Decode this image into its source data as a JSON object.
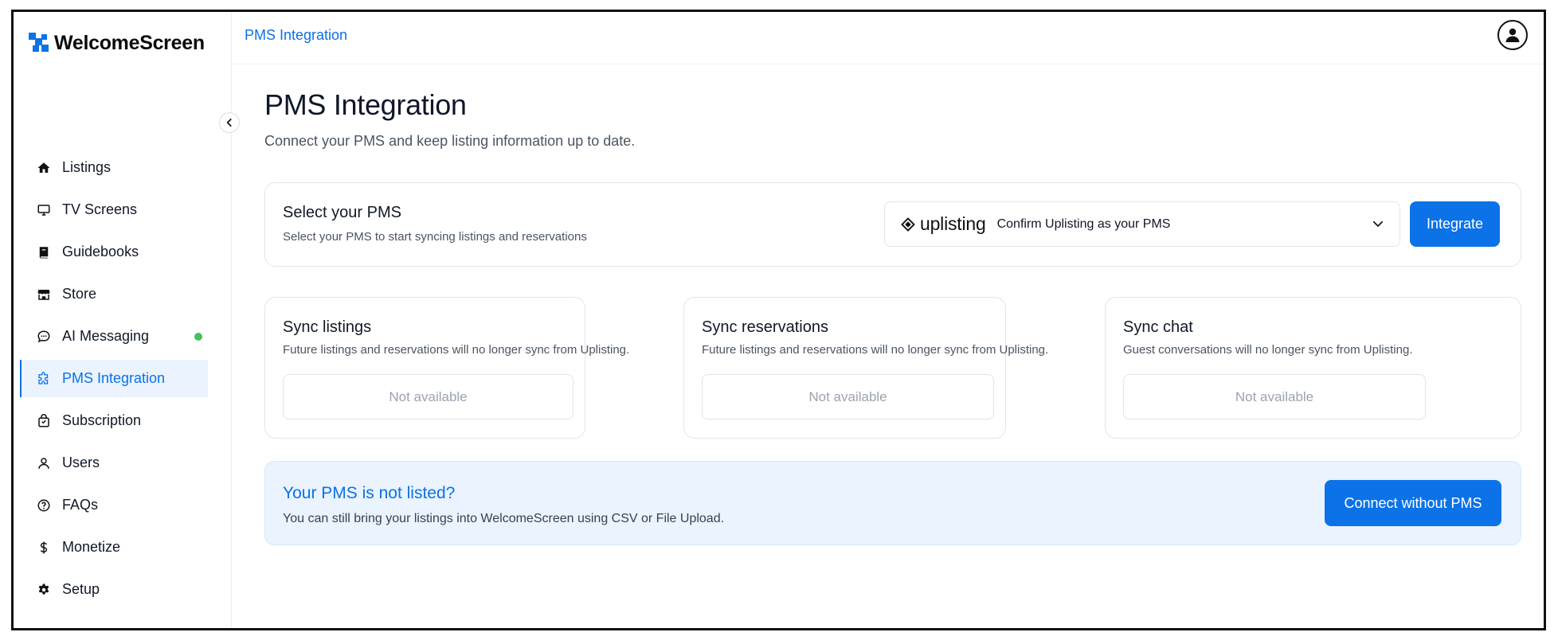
{
  "app": {
    "brand": "WelcomeScreen"
  },
  "sidebar": {
    "items": [
      {
        "label": "Listings",
        "icon": "home-icon"
      },
      {
        "label": "TV Screens",
        "icon": "monitor-icon"
      },
      {
        "label": "Guidebooks",
        "icon": "book-icon"
      },
      {
        "label": "Store",
        "icon": "store-icon"
      },
      {
        "label": "AI Messaging",
        "icon": "chat-icon",
        "status": "online"
      },
      {
        "label": "PMS Integration",
        "icon": "puzzle-icon",
        "active": true
      },
      {
        "label": "Subscription",
        "icon": "bag-icon"
      },
      {
        "label": "Users",
        "icon": "user-icon"
      },
      {
        "label": "FAQs",
        "icon": "help-icon"
      },
      {
        "label": "Monetize",
        "icon": "dollar-icon"
      },
      {
        "label": "Setup",
        "icon": "gear-icon"
      }
    ]
  },
  "topbar": {
    "breadcrumb": "PMS Integration"
  },
  "main": {
    "title": "PMS Integration",
    "subtitle": "Connect your PMS and keep listing information up to date.",
    "select": {
      "title": "Select your PMS",
      "subtitle": "Select your PMS to start syncing listings and reservations",
      "pms_name": "uplisting",
      "selected_option": "Confirm Uplisting as your PMS",
      "integrate_label": "Integrate"
    },
    "sync_cards": [
      {
        "title": "Sync listings",
        "subtitle": "Future listings and reservations will no longer sync from Uplisting.",
        "button": "Not available"
      },
      {
        "title": "Sync reservations",
        "subtitle": "Future listings and reservations will no longer sync from Uplisting.",
        "button": "Not available"
      },
      {
        "title": "Sync chat",
        "subtitle": "Guest conversations will no longer sync from Uplisting.",
        "button": "Not available"
      }
    ],
    "banner": {
      "title": "Your PMS is not listed?",
      "subtitle": "You can still bring your listings into WelcomeScreen using CSV or File Upload.",
      "button": "Connect without PMS"
    }
  },
  "colors": {
    "accent": "#0b72e7",
    "active_bg": "#eaf3fe",
    "status_online": "#45c05a"
  }
}
